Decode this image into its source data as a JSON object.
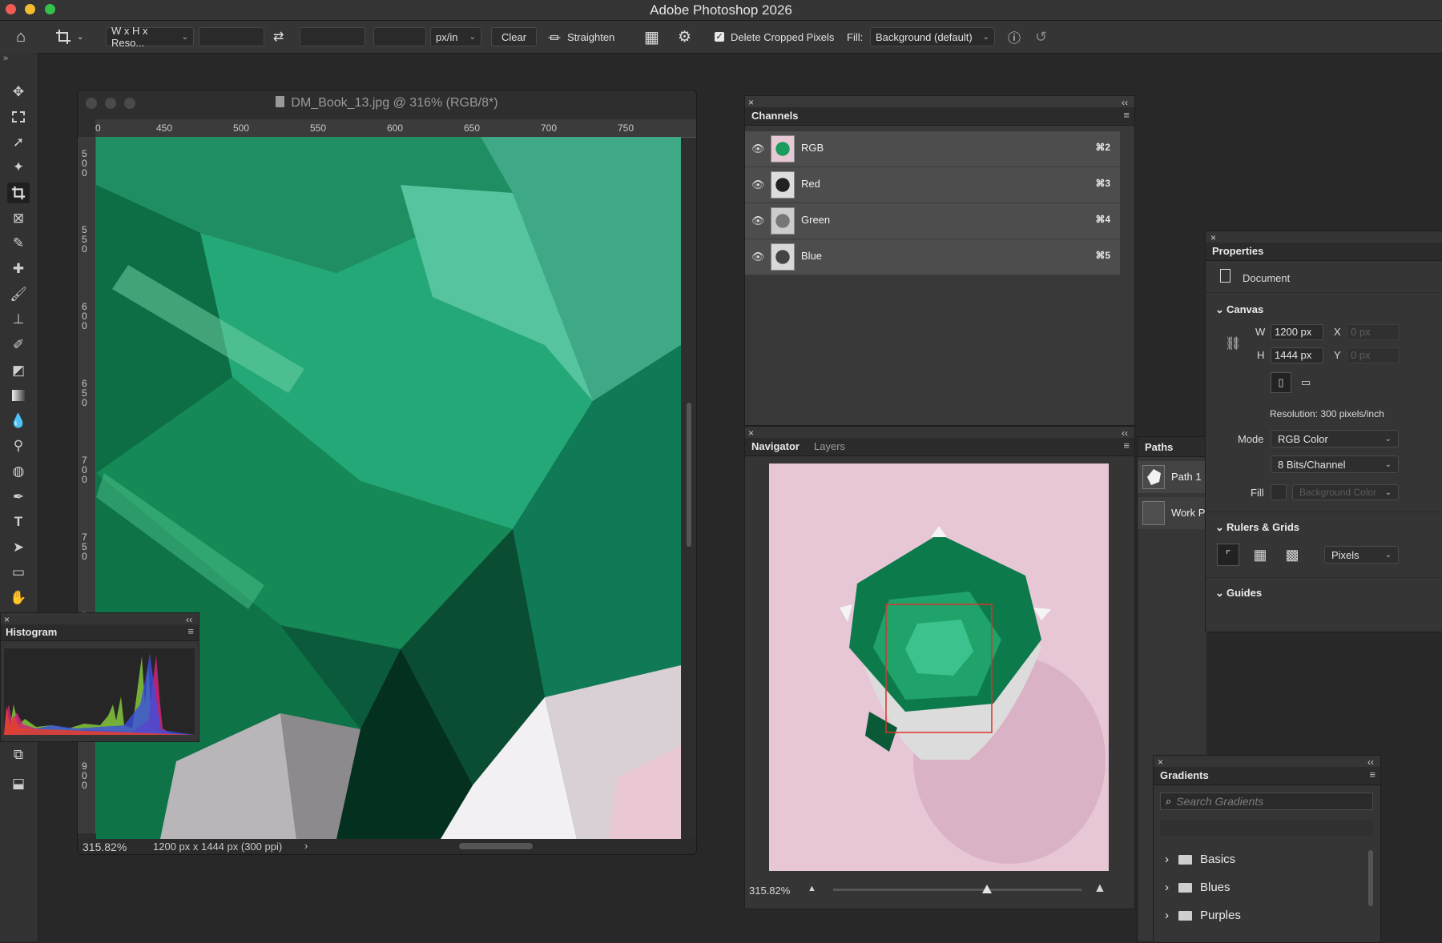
{
  "app": {
    "title": "Adobe Photoshop 2026"
  },
  "options_bar": {
    "ratio_select": "W x H x Reso...",
    "unit_select": "px/in",
    "clear_label": "Clear",
    "straighten_label": "Straighten",
    "delete_cropped_label": "Delete Cropped Pixels",
    "delete_cropped_checked": true,
    "fill_label": "Fill:",
    "fill_select": "Background (default)"
  },
  "document": {
    "title": "DM_Book_13.jpg @ 316% (RGB/8*)",
    "ruler_x": [
      "0",
      "450",
      "500",
      "550",
      "600",
      "650",
      "700",
      "750"
    ],
    "ruler_y": [
      "500",
      "550",
      "600",
      "650",
      "700",
      "750",
      "800",
      "900"
    ],
    "zoom": "315.82%",
    "info": "1200 px x 1444 px (300 ppi)"
  },
  "histogram": {
    "title": "Histogram"
  },
  "channels": {
    "title": "Channels",
    "rows": [
      {
        "name": "RGB",
        "shortcut": "⌘2"
      },
      {
        "name": "Red",
        "shortcut": "⌘3"
      },
      {
        "name": "Green",
        "shortcut": "⌘4"
      },
      {
        "name": "Blue",
        "shortcut": "⌘5"
      }
    ]
  },
  "navigator": {
    "tab_navigator": "Navigator",
    "tab_layers": "Layers",
    "zoom": "315.82%",
    "zoom_level": 0.62
  },
  "paths": {
    "title": "Paths",
    "items": [
      "Path 1",
      "Work P"
    ]
  },
  "properties": {
    "title": "Properties",
    "document_label": "Document",
    "canvas_section": "Canvas",
    "w_label": "W",
    "w_value": "1200 px",
    "h_label": "H",
    "h_value": "1444 px",
    "x_label": "X",
    "x_value": "0 px",
    "y_label": "Y",
    "y_value": "0 px",
    "resolution": "Resolution: 300 pixels/inch",
    "mode_label": "Mode",
    "mode_value": "RGB Color",
    "depth_value": "8 Bits/Channel",
    "fill_label": "Fill",
    "fill_value": "Background Color",
    "rulers_section": "Rulers & Grids",
    "units_value": "Pixels",
    "guides_section": "Guides"
  },
  "gradients": {
    "title": "Gradients",
    "search_placeholder": "Search Gradients",
    "folders": [
      "Basics",
      "Blues",
      "Purples"
    ]
  }
}
